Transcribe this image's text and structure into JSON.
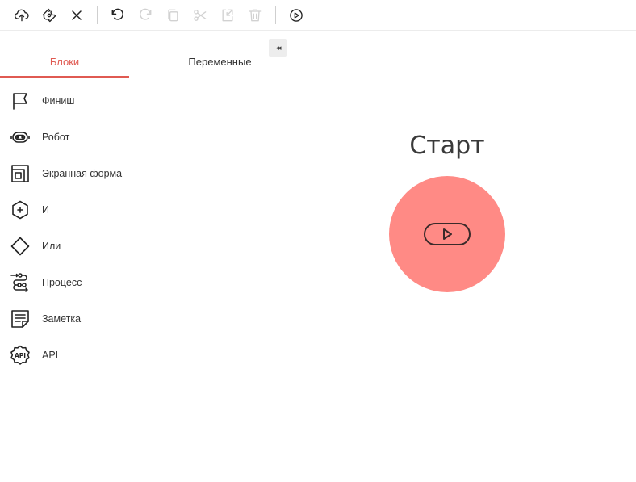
{
  "toolbar": {
    "buttons": [
      {
        "icon": "cloud-upload-icon"
      },
      {
        "icon": "wrench-settings-icon"
      },
      {
        "icon": "close-icon"
      },
      {
        "icon": "undo-icon"
      },
      {
        "icon": "redo-icon"
      },
      {
        "icon": "copy-icon"
      },
      {
        "icon": "cut-icon"
      },
      {
        "icon": "paste-icon"
      },
      {
        "icon": "delete-icon"
      },
      {
        "icon": "run-icon"
      }
    ],
    "disabled": [
      "redo-icon",
      "copy-icon",
      "cut-icon",
      "paste-icon",
      "delete-icon"
    ]
  },
  "sidebar": {
    "collapse_label": "◂◂",
    "tabs": [
      {
        "label": "Блоки",
        "active": true
      },
      {
        "label": "Переменные",
        "active": false
      }
    ],
    "blocks": [
      {
        "label": "Финиш",
        "icon": "flag-icon"
      },
      {
        "label": "Робот",
        "icon": "robot-icon"
      },
      {
        "label": "Экранная форма",
        "icon": "screen-form-icon"
      },
      {
        "label": "И",
        "icon": "and-hexagon-icon"
      },
      {
        "label": "Или",
        "icon": "or-diamond-icon"
      },
      {
        "label": "Процесс",
        "icon": "process-icon"
      },
      {
        "label": "Заметка",
        "icon": "note-icon"
      },
      {
        "label": "API",
        "icon": "api-badge-icon"
      }
    ]
  },
  "canvas": {
    "start_node": {
      "title": "Старт",
      "icon": "play-pill-icon",
      "color": "#ff8a85"
    }
  },
  "colors": {
    "accent": "#e05a52",
    "start_node": "#ff8a85"
  }
}
